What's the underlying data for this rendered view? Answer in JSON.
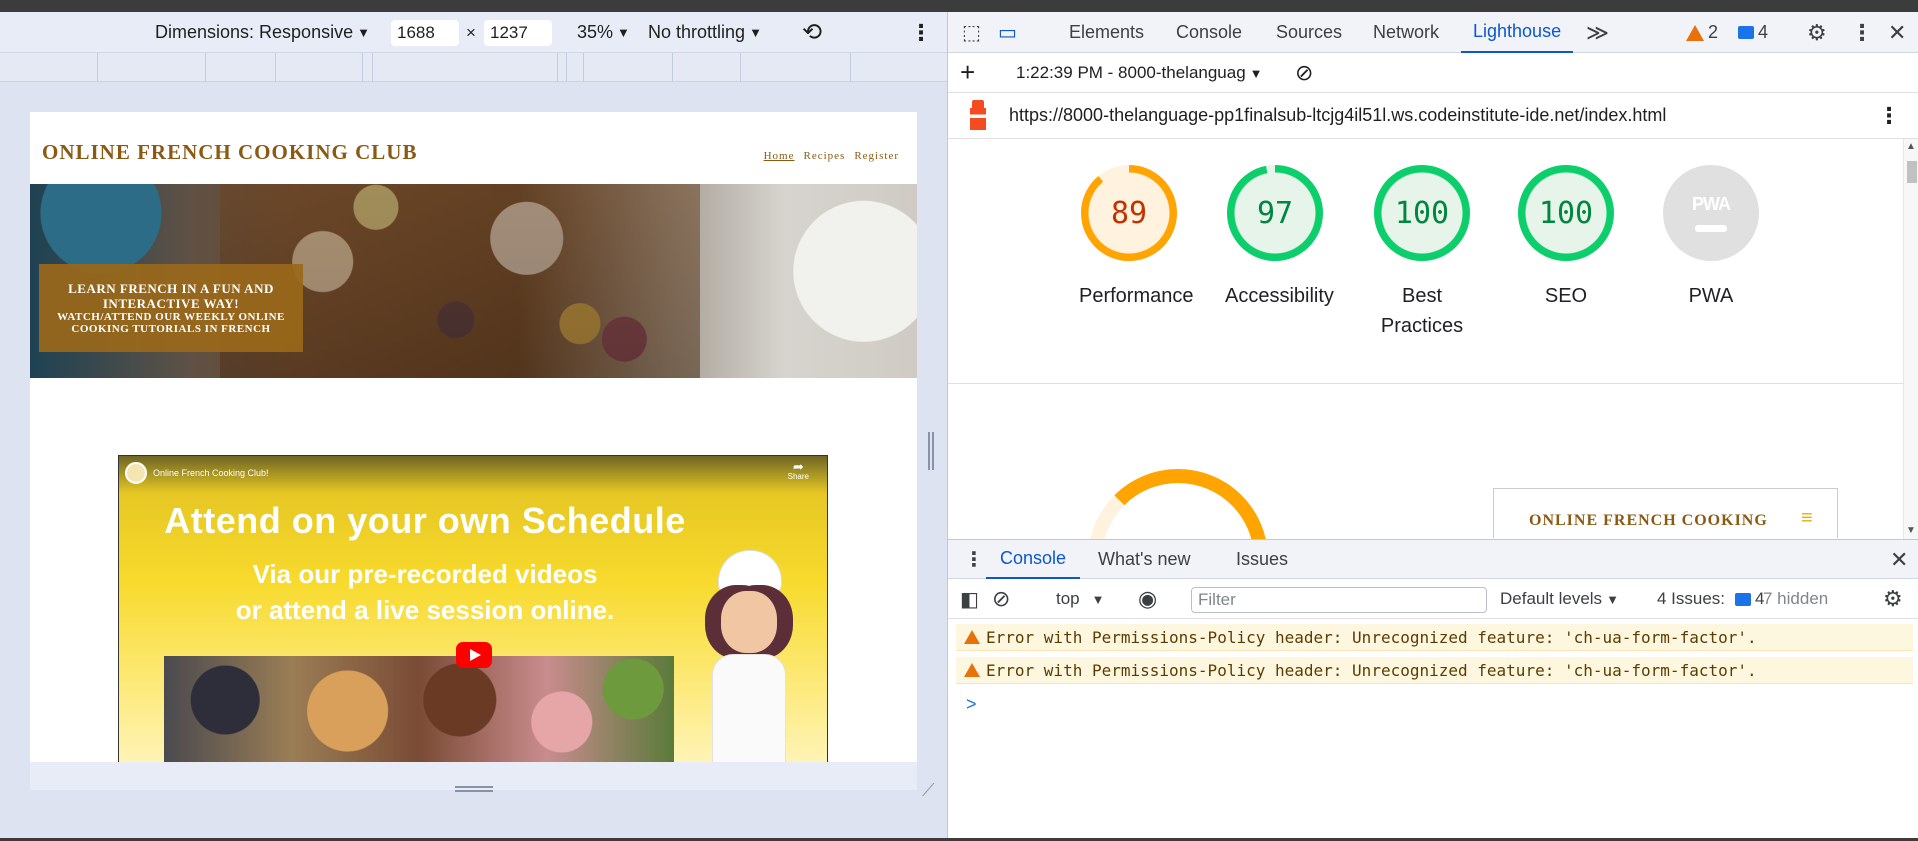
{
  "device_toolbar": {
    "dimensions_label": "Dimensions: Responsive",
    "width": "1688",
    "times": "×",
    "height": "1237",
    "zoom": "35%",
    "throttling": "No throttling"
  },
  "site": {
    "title": "ONLINE FRENCH COOKING CLUB",
    "nav": [
      "Home",
      "Recipes",
      "Register"
    ],
    "hero_line1": "LEARN FRENCH IN A FUN AND INTERACTIVE WAY!",
    "hero_line2": "WATCH/ATTEND OUR WEEKLY ONLINE COOKING TUTORIALS IN FRENCH",
    "video_channel": "Online French Cooking Club!",
    "video_share": "Share",
    "video_heading": "Attend on your own Schedule",
    "video_sub1": "Via our pre-recorded videos",
    "video_sub2": "or attend a live session online."
  },
  "devtools": {
    "tabs": [
      "Elements",
      "Console",
      "Sources",
      "Network",
      "Lighthouse"
    ],
    "active_tab": "Lighthouse",
    "more_tabs": "≫",
    "warning_count": "2",
    "message_count": "4",
    "lighthouse": {
      "report_time": "1:22:39 PM - 8000-thelanguag",
      "url": "https://8000-thelanguage-pp1finalsub-ltcjg4il51l.ws.codeinstitute-ide.net/index.html",
      "scores": [
        {
          "label": "Performance",
          "value": "89"
        },
        {
          "label": "Accessibility",
          "value": "97"
        },
        {
          "label": "Best Practices",
          "value": "100"
        },
        {
          "label": "SEO",
          "value": "100"
        },
        {
          "label": "PWA",
          "value": "PWA"
        }
      ],
      "preview_title": "ONLINE FRENCH COOKING"
    },
    "drawer": {
      "tabs": [
        "Console",
        "What's new",
        "Issues"
      ],
      "context": "top",
      "filter_placeholder": "Filter",
      "levels": "Default levels",
      "issues_label": "4 Issues:",
      "issues_count": "4",
      "hidden": "7 hidden",
      "messages": [
        "Error with Permissions-Policy header: Unrecognized feature: 'ch-ua-form-factor'.",
        "Error with Permissions-Policy header: Unrecognized feature: 'ch-ua-form-factor'."
      ],
      "prompt": ">"
    }
  },
  "colors": {
    "accent": "#0b57d0",
    "score_orange": "#ffa400",
    "score_green": "#0cce6b",
    "brand_brown": "#8a5a12",
    "warning": "#e8710a"
  }
}
